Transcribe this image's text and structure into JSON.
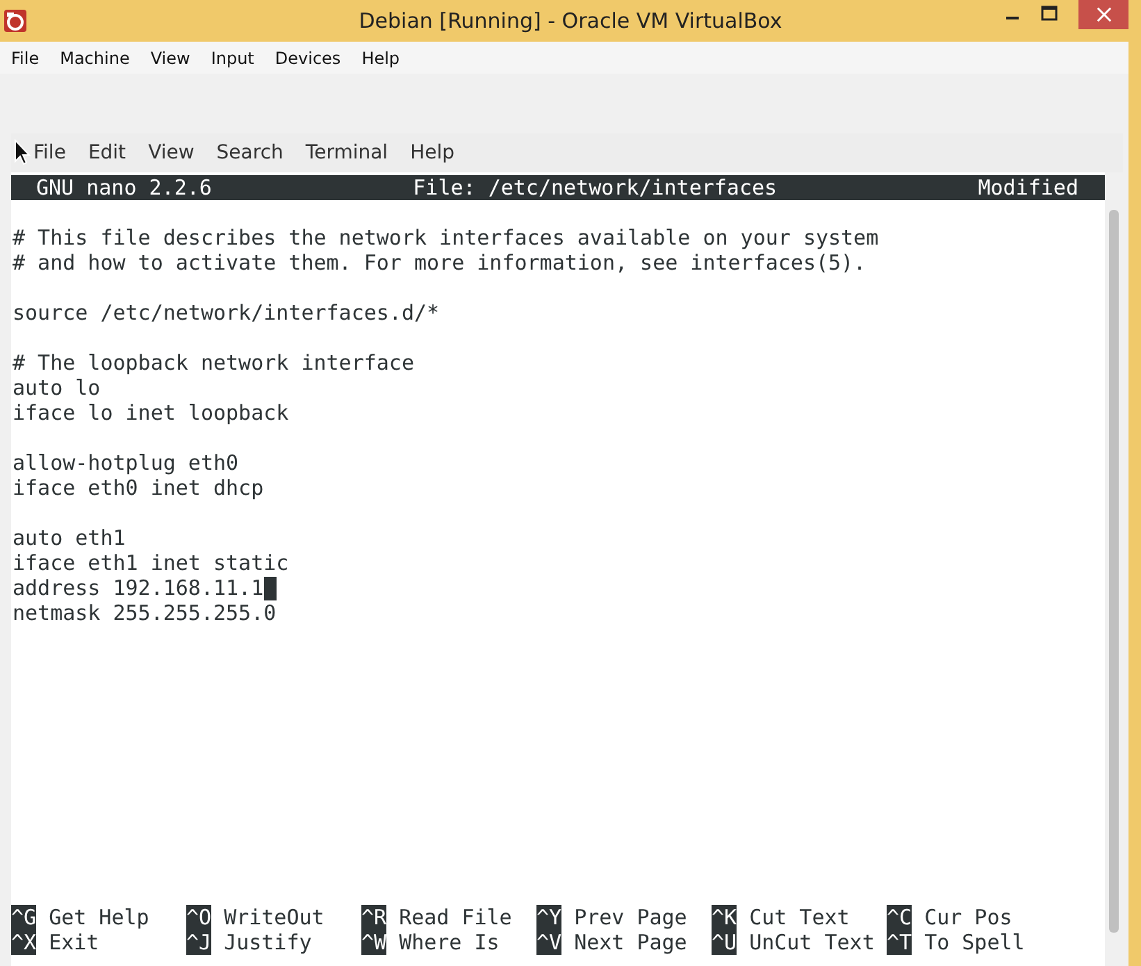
{
  "window": {
    "title": "Debian [Running] - Oracle VM VirtualBox"
  },
  "menu": [
    "File",
    "Machine",
    "View",
    "Input",
    "Devices",
    "Help"
  ],
  "terminal_menu": [
    "File",
    "Edit",
    "View",
    "Search",
    "Terminal",
    "Help"
  ],
  "nano_header": {
    "version": "GNU nano 2.2.6",
    "file": "File: /etc/network/interfaces",
    "status": "Modified"
  },
  "lines": [
    {
      "kind": "blank",
      "cursor": false
    },
    {
      "kind": "text",
      "text": "# This file describes the network interfaces available on your system",
      "cursor": false
    },
    {
      "kind": "text",
      "text": "# and how to activate them. For more information, see interfaces(5).",
      "cursor": false
    },
    {
      "kind": "blank",
      "cursor": false
    },
    {
      "kind": "text",
      "text": "source /etc/network/interfaces.d/*",
      "cursor": false
    },
    {
      "kind": "blank",
      "cursor": false
    },
    {
      "kind": "text",
      "text": "# The loopback network interface",
      "cursor": false
    },
    {
      "kind": "text",
      "text": "auto lo",
      "cursor": false
    },
    {
      "kind": "text",
      "text": "iface lo inet loopback",
      "cursor": false
    },
    {
      "kind": "blank",
      "cursor": false
    },
    {
      "kind": "text",
      "text": "allow-hotplug eth0",
      "cursor": false
    },
    {
      "kind": "text",
      "text": "iface eth0 inet dhcp",
      "cursor": false
    },
    {
      "kind": "blank",
      "cursor": false
    },
    {
      "kind": "text",
      "text": "auto eth1",
      "cursor": false
    },
    {
      "kind": "text",
      "text": "iface eth1 inet static",
      "cursor": false
    },
    {
      "kind": "text",
      "text": "address 192.168.11.1",
      "cursor": true
    },
    {
      "kind": "text",
      "text": "netmask 255.255.255.0",
      "cursor": false
    }
  ],
  "shortcuts": [
    [
      {
        "key": "^G",
        "label": "Get Help"
      },
      {
        "key": "^X",
        "label": "Exit"
      }
    ],
    [
      {
        "key": "^O",
        "label": "WriteOut"
      },
      {
        "key": "^J",
        "label": "Justify"
      }
    ],
    [
      {
        "key": "^R",
        "label": "Read File"
      },
      {
        "key": "^W",
        "label": "Where Is"
      }
    ],
    [
      {
        "key": "^Y",
        "label": "Prev Page"
      },
      {
        "key": "^V",
        "label": "Next Page"
      }
    ],
    [
      {
        "key": "^K",
        "label": "Cut Text"
      },
      {
        "key": "^U",
        "label": "UnCut Text"
      }
    ],
    [
      {
        "key": "^C",
        "label": "Cur Pos"
      },
      {
        "key": "^T",
        "label": "To Spell"
      }
    ]
  ]
}
